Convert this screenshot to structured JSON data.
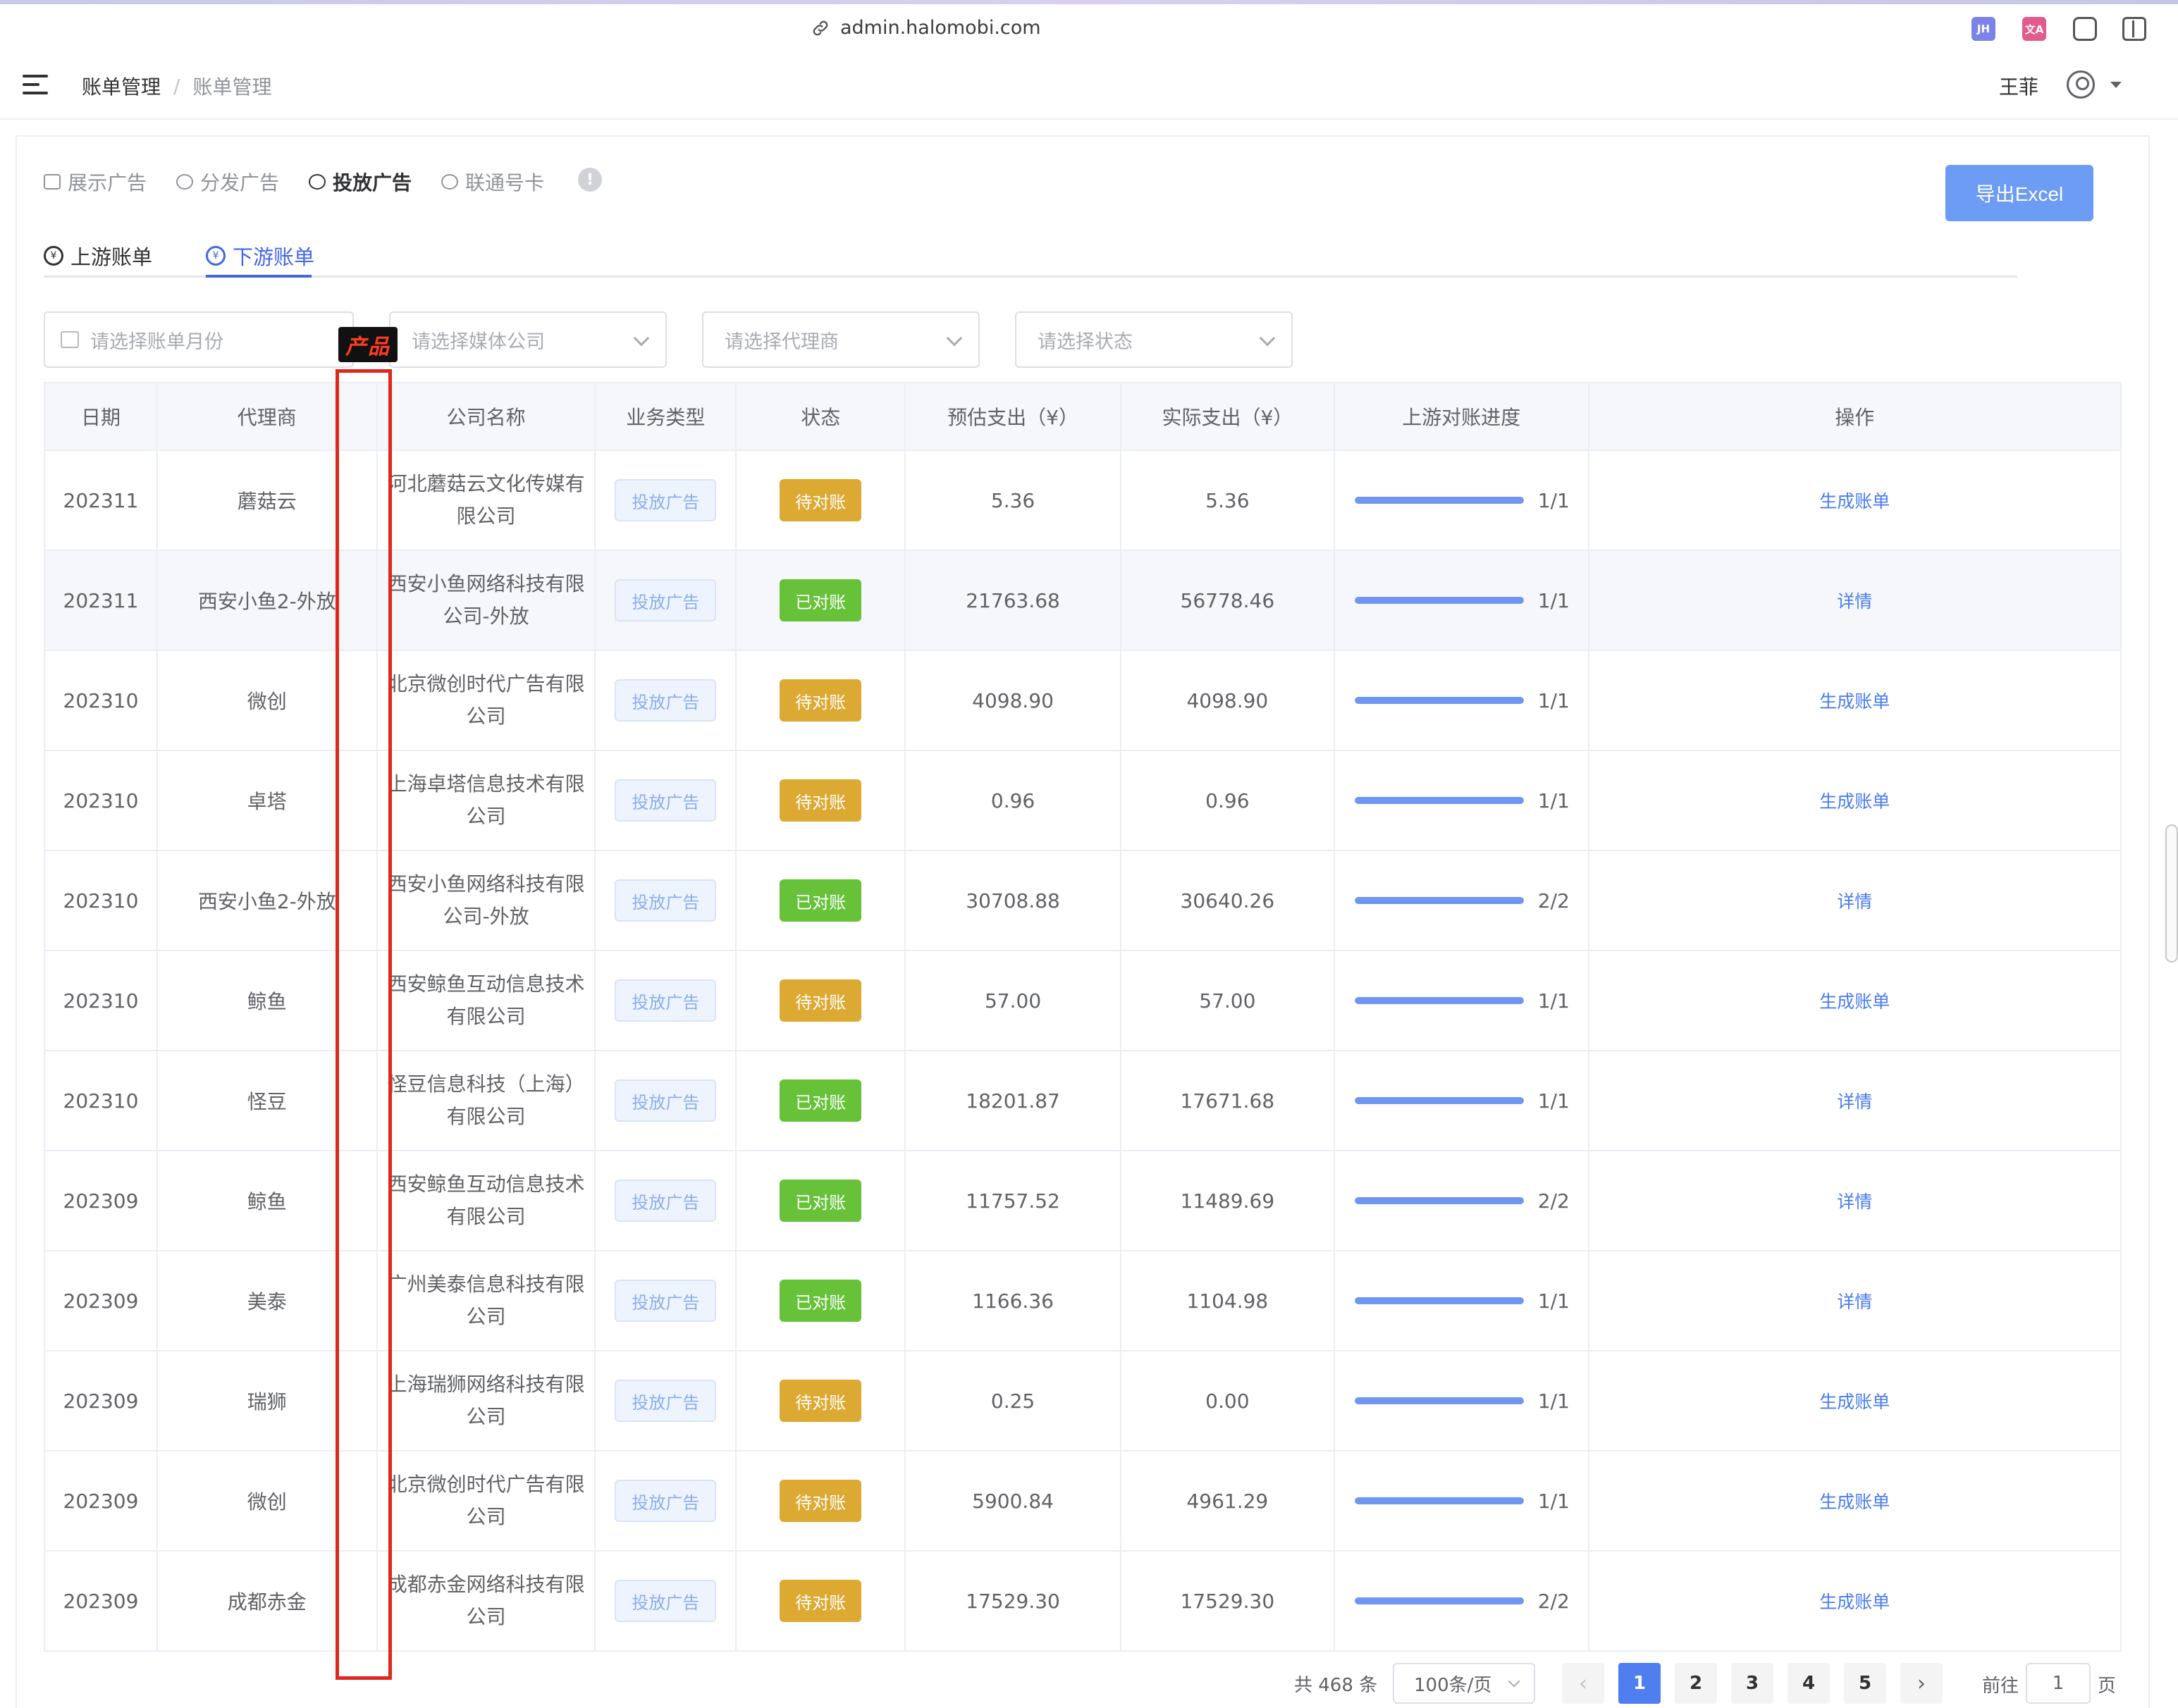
{
  "browser": {
    "url": "admin.halomobi.com",
    "extensions": [
      "JH",
      "文A",
      "",
      ""
    ]
  },
  "header": {
    "breadcrumb": [
      "账单管理",
      "账单管理"
    ],
    "breadcrumb_sep": "/",
    "username": "王菲"
  },
  "biz_tabs": [
    {
      "label": "展示广告",
      "icon": "ad-icon",
      "active": false
    },
    {
      "label": "分发广告",
      "icon": "drop-icon",
      "active": false
    },
    {
      "label": "投放广告",
      "icon": "target-icon",
      "active": true
    },
    {
      "label": "联通号卡",
      "icon": "unicom-icon",
      "active": false
    }
  ],
  "info_icon": "!",
  "export_label": "导出Excel",
  "sub_tabs": {
    "upstream": "上游账单",
    "downstream": "下游账单",
    "active": "downstream"
  },
  "filters": {
    "month_placeholder": "请选择账单月份",
    "media_placeholder": "请选择媒体公司",
    "agent_placeholder": "请选择代理商",
    "status_placeholder": "请选择状态"
  },
  "annotation": {
    "label": "产品"
  },
  "table": {
    "columns": [
      "日期",
      "代理商",
      "",
      "公司名称",
      "业务类型",
      "状态",
      "预估支出（¥）",
      "实际支出（¥）",
      "上游对账进度",
      "操作"
    ],
    "rows": [
      {
        "date": "202311",
        "agent": "蘑菇云",
        "company": "河北蘑菇云文化传媒有限公司",
        "biz": "投放广告",
        "status": "待对账",
        "est": "5.36",
        "actual": "5.36",
        "progress": "1/1",
        "progress_pct": 100,
        "op": "生成账单"
      },
      {
        "date": "202311",
        "agent": "西安小鱼2-外放",
        "company": "西安小鱼网络科技有限公司-外放",
        "biz": "投放广告",
        "status": "已对账",
        "est": "21763.68",
        "actual": "56778.46",
        "progress": "1/1",
        "progress_pct": 100,
        "op": "详情"
      },
      {
        "date": "202310",
        "agent": "微创",
        "company": "北京微创时代广告有限公司",
        "biz": "投放广告",
        "status": "待对账",
        "est": "4098.90",
        "actual": "4098.90",
        "progress": "1/1",
        "progress_pct": 100,
        "op": "生成账单"
      },
      {
        "date": "202310",
        "agent": "卓塔",
        "company": "上海卓塔信息技术有限公司",
        "biz": "投放广告",
        "status": "待对账",
        "est": "0.96",
        "actual": "0.96",
        "progress": "1/1",
        "progress_pct": 100,
        "op": "生成账单"
      },
      {
        "date": "202310",
        "agent": "西安小鱼2-外放",
        "company": "西安小鱼网络科技有限公司-外放",
        "biz": "投放广告",
        "status": "已对账",
        "est": "30708.88",
        "actual": "30640.26",
        "progress": "2/2",
        "progress_pct": 100,
        "op": "详情"
      },
      {
        "date": "202310",
        "agent": "鲸鱼",
        "company": "西安鲸鱼互动信息技术有限公司",
        "biz": "投放广告",
        "status": "待对账",
        "est": "57.00",
        "actual": "57.00",
        "progress": "1/1",
        "progress_pct": 100,
        "op": "生成账单"
      },
      {
        "date": "202310",
        "agent": "怪豆",
        "company": "怪豆信息科技（上海）有限公司",
        "biz": "投放广告",
        "status": "已对账",
        "est": "18201.87",
        "actual": "17671.68",
        "progress": "1/1",
        "progress_pct": 100,
        "op": "详情"
      },
      {
        "date": "202309",
        "agent": "鲸鱼",
        "company": "西安鲸鱼互动信息技术有限公司",
        "biz": "投放广告",
        "status": "已对账",
        "est": "11757.52",
        "actual": "11489.69",
        "progress": "2/2",
        "progress_pct": 100,
        "op": "详情"
      },
      {
        "date": "202309",
        "agent": "美泰",
        "company": "广州美泰信息科技有限公司",
        "biz": "投放广告",
        "status": "已对账",
        "est": "1166.36",
        "actual": "1104.98",
        "progress": "1/1",
        "progress_pct": 100,
        "op": "详情"
      },
      {
        "date": "202309",
        "agent": "瑞狮",
        "company": "上海瑞狮网络科技有限公司",
        "biz": "投放广告",
        "status": "待对账",
        "est": "0.25",
        "actual": "0.00",
        "progress": "1/1",
        "progress_pct": 100,
        "op": "生成账单"
      },
      {
        "date": "202309",
        "agent": "微创",
        "company": "北京微创时代广告有限公司",
        "biz": "投放广告",
        "status": "待对账",
        "est": "5900.84",
        "actual": "4961.29",
        "progress": "1/1",
        "progress_pct": 100,
        "op": "生成账单"
      },
      {
        "date": "202309",
        "agent": "成都赤金",
        "company": "成都赤金网络科技有限公司",
        "biz": "投放广告",
        "status": "待对账",
        "est": "17529.30",
        "actual": "17529.30",
        "progress": "2/2",
        "progress_pct": 100,
        "op": "生成账单"
      }
    ]
  },
  "pagination": {
    "total_text": "共 468 条",
    "page_size": "100条/页",
    "pages": [
      "1",
      "2",
      "3",
      "4",
      "5"
    ],
    "current_page": "1",
    "prev": "‹",
    "next": "›",
    "jump_prefix": "前往",
    "jump_value": "1",
    "jump_suffix": "页"
  },
  "colors": {
    "primary": "#4167e8",
    "export_button": "#6c9cf3",
    "status_pending": "#dcaa33",
    "status_done": "#67c23a",
    "progress": "#6f97f1",
    "annotation": "#e0271c"
  }
}
